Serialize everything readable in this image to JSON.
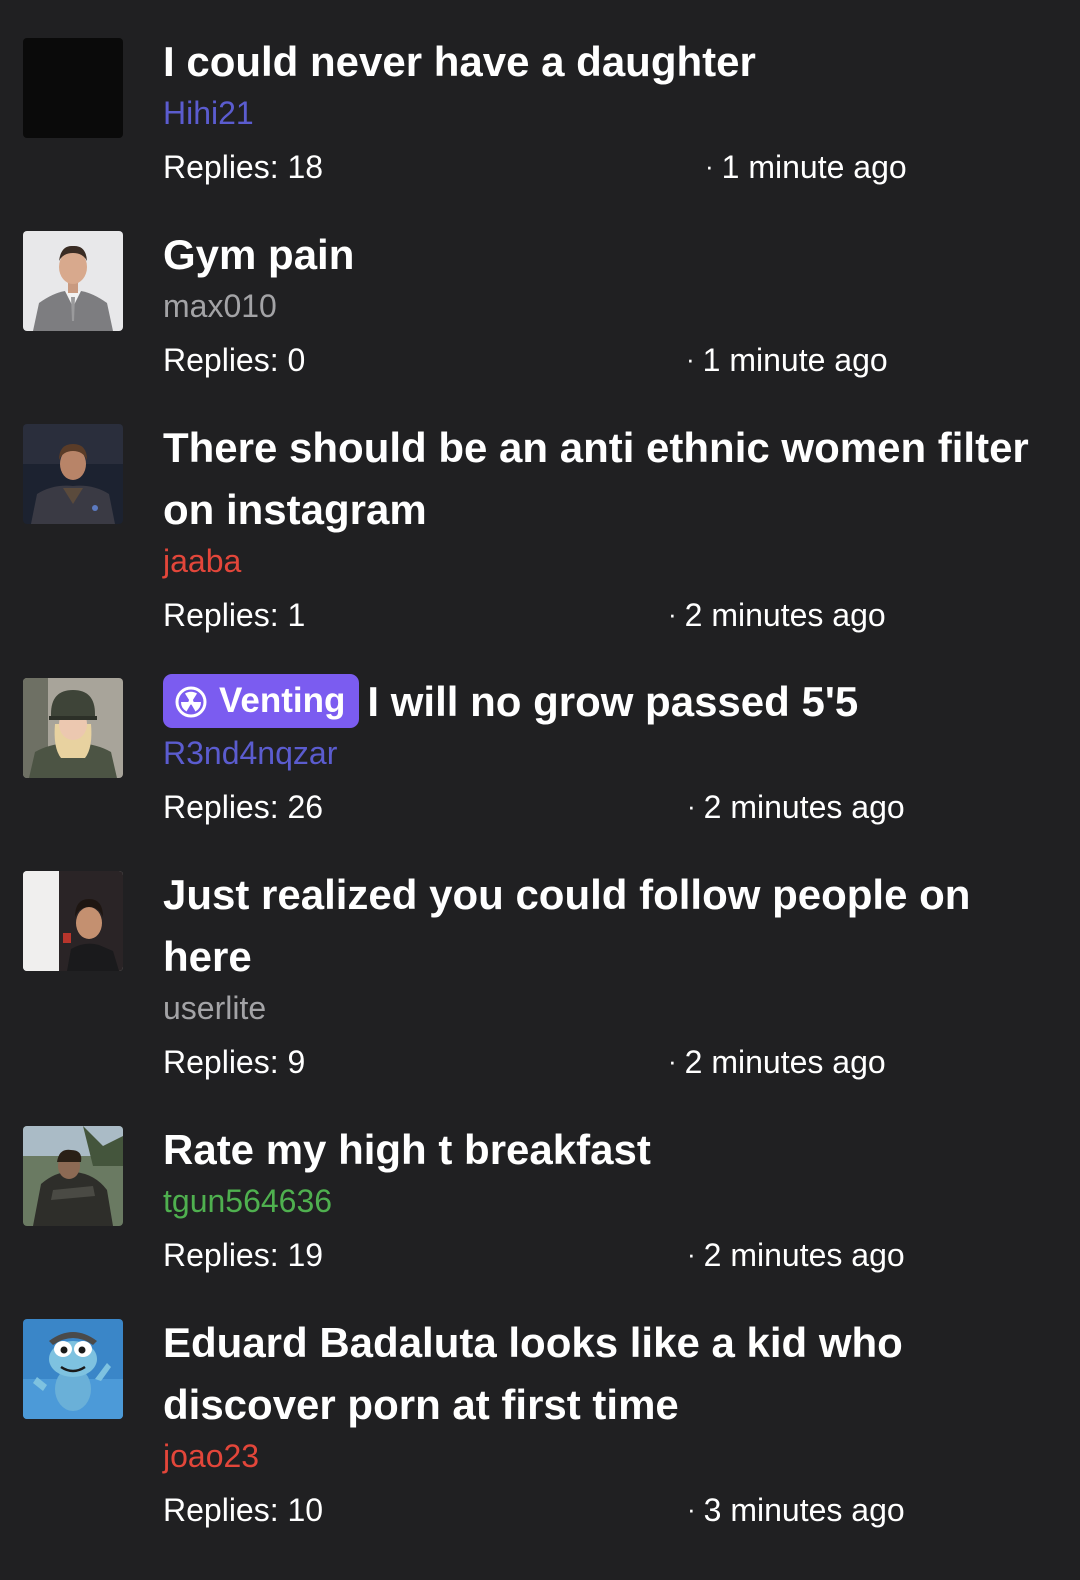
{
  "threads": [
    {
      "title": "I could never have a daughter",
      "username": "Hihi21",
      "username_color": "#5b5ccf",
      "replies": "Replies: 18",
      "time": "1 minute ago",
      "avatar": "black-avatar"
    },
    {
      "title": "Gym pain",
      "username": "max010",
      "username_color": "#a3a3a6",
      "replies": "Replies: 0",
      "time": "1 minute ago",
      "avatar": "man-in-suit-avatar"
    },
    {
      "title": "There should be an anti ethnic women filter on instagram",
      "username": "jaaba",
      "username_color": "#e3463a",
      "replies": "Replies: 1",
      "time": "2 minutes ago",
      "avatar": "man-in-jacket-avatar"
    },
    {
      "tag": "Venting",
      "tag_icon": "radiation-icon",
      "tag_color": "#7b5cf0",
      "title": "I will no grow passed 5'5",
      "username": "R3nd4nqzar",
      "username_color": "#5b5ccf",
      "replies": "Replies: 26",
      "time": "2 minutes ago",
      "avatar": "soldier-helmet-avatar"
    },
    {
      "title": "Just realized you could follow people on here",
      "username": "userlite",
      "username_color": "#a3a3a6",
      "replies": "Replies: 9",
      "time": "2 minutes ago",
      "avatar": "selfie-man-avatar"
    },
    {
      "title": "Rate my high t breakfast",
      "username": "tgun564636",
      "username_color": "#4fb04f",
      "replies": "Replies: 19",
      "time": "2 minutes ago",
      "avatar": "armored-warrior-avatar"
    },
    {
      "title": "Eduard Badaluta looks like a kid who discover porn at first time",
      "username": "joao23",
      "username_color": "#e3463a",
      "replies": "Replies: 10",
      "time": "3 minutes ago",
      "avatar": "crazy-frog-avatar"
    }
  ]
}
